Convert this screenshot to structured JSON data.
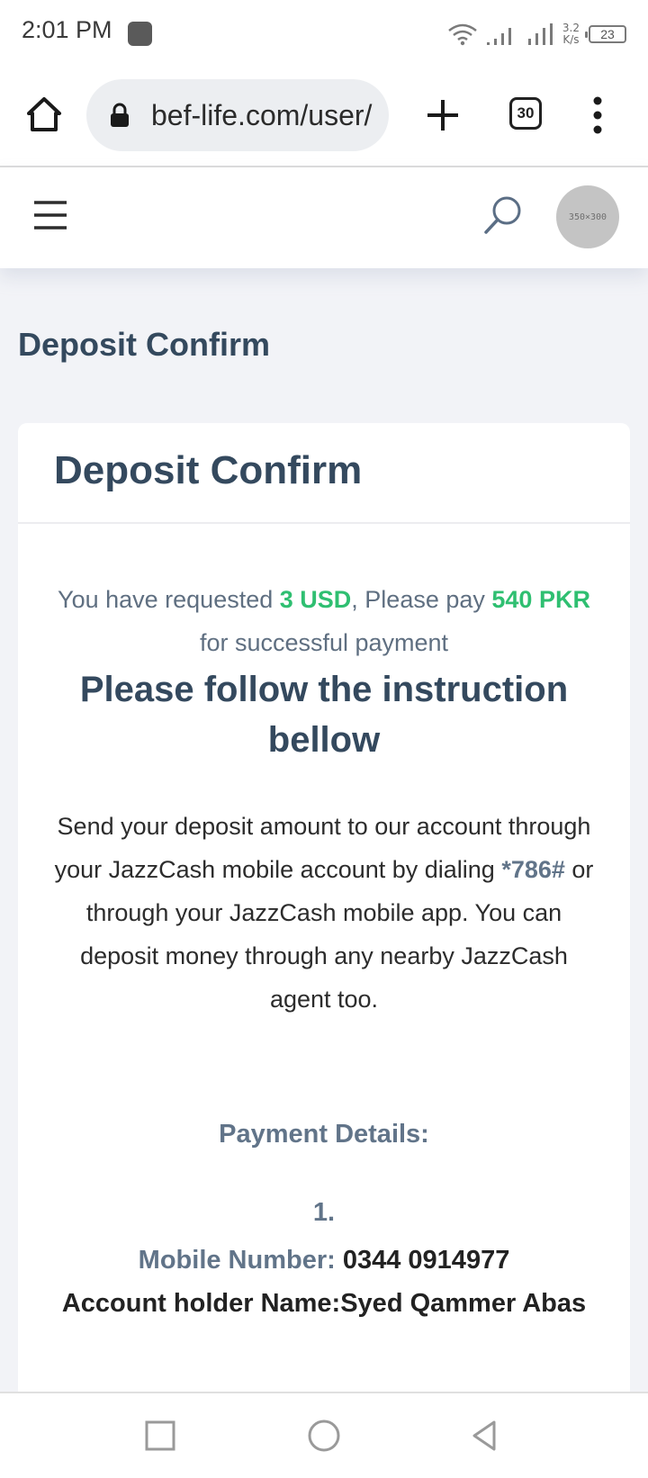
{
  "status_bar": {
    "time": "2:01 PM",
    "net_speed_value": "3.2",
    "net_speed_unit": "K/s",
    "battery": "23"
  },
  "browser": {
    "url": "bef-life.com/user/",
    "tab_count": "30"
  },
  "site_header": {
    "avatar_placeholder": "350×300"
  },
  "page": {
    "title": "Deposit Confirm"
  },
  "card": {
    "title": "Deposit Confirm",
    "request": {
      "prefix": "You have requested ",
      "amount": "3 USD",
      "middle": ", Please pay ",
      "pay_amount": "540 PKR",
      "suffix": " for successful payment"
    },
    "instruction_heading": "Please follow the instruction bellow",
    "instruction": {
      "part1": "Send your deposit amount to our account through your JazzCash mobile account by dialing ",
      "code": "*786#",
      "part2": " or through your JazzCash mobile app. You can deposit money through any nearby JazzCash agent too."
    },
    "payment_details_heading": "Payment Details:",
    "payment_items": [
      {
        "number": "1.",
        "mobile_label": "Mobile Number:",
        "mobile_value": " 0344 0914977",
        "holder": "Account holder Name:Syed Qammer Abas"
      }
    ]
  },
  "colors": {
    "accent_green": "#2fbf71",
    "heading": "#34495e",
    "muted": "#617489"
  }
}
